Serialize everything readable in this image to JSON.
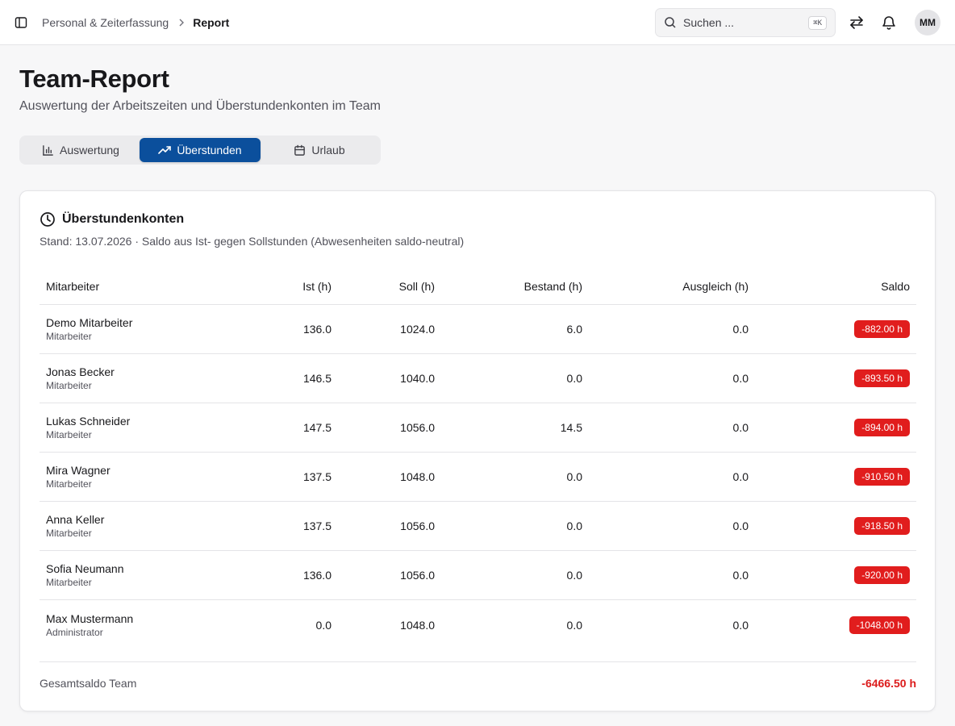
{
  "topbar": {
    "breadcrumb_parent": "Personal & Zeiterfassung",
    "breadcrumb_current": "Report",
    "search_placeholder": "Suchen ...",
    "search_shortcut": "⌘K",
    "avatar_initials": "MM"
  },
  "page": {
    "title": "Team-Report",
    "subtitle": "Auswertung der Arbeitszeiten und Überstundenkonten im Team"
  },
  "tabs": [
    {
      "label": "Auswertung",
      "icon": "bar-chart-icon",
      "active": false
    },
    {
      "label": "Überstunden",
      "icon": "trending-up-icon",
      "active": true
    },
    {
      "label": "Urlaub",
      "icon": "calendar-icon",
      "active": false
    }
  ],
  "card": {
    "title": "Überstundenkonten",
    "description": "Stand: 13.07.2026 · Saldo aus Ist- gegen Sollstunden (Abwesenheiten saldo-neutral)",
    "columns": {
      "name": "Mitarbeiter",
      "ist": "Ist (h)",
      "soll": "Soll (h)",
      "bestand": "Bestand (h)",
      "ausgleich": "Ausgleich (h)",
      "saldo": "Saldo"
    },
    "rows": [
      {
        "name": "Demo Mitarbeiter",
        "role": "Mitarbeiter",
        "ist": "136.0",
        "soll": "1024.0",
        "bestand": "6.0",
        "ausgleich": "0.0",
        "saldo": "-882.00 h"
      },
      {
        "name": "Jonas Becker",
        "role": "Mitarbeiter",
        "ist": "146.5",
        "soll": "1040.0",
        "bestand": "0.0",
        "ausgleich": "0.0",
        "saldo": "-893.50 h"
      },
      {
        "name": "Lukas Schneider",
        "role": "Mitarbeiter",
        "ist": "147.5",
        "soll": "1056.0",
        "bestand": "14.5",
        "ausgleich": "0.0",
        "saldo": "-894.00 h"
      },
      {
        "name": "Mira Wagner",
        "role": "Mitarbeiter",
        "ist": "137.5",
        "soll": "1048.0",
        "bestand": "0.0",
        "ausgleich": "0.0",
        "saldo": "-910.50 h"
      },
      {
        "name": "Anna Keller",
        "role": "Mitarbeiter",
        "ist": "137.5",
        "soll": "1056.0",
        "bestand": "0.0",
        "ausgleich": "0.0",
        "saldo": "-918.50 h"
      },
      {
        "name": "Sofia Neumann",
        "role": "Mitarbeiter",
        "ist": "136.0",
        "soll": "1056.0",
        "bestand": "0.0",
        "ausgleich": "0.0",
        "saldo": "-920.00 h"
      },
      {
        "name": "Max Mustermann",
        "role": "Administrator",
        "ist": "0.0",
        "soll": "1048.0",
        "bestand": "0.0",
        "ausgleich": "0.0",
        "saldo": "-1048.00 h"
      }
    ],
    "total_label": "Gesamtsaldo Team",
    "total_value": "-6466.50 h"
  },
  "colors": {
    "accent": "#0b4f9c",
    "negative": "#e11d1d"
  }
}
